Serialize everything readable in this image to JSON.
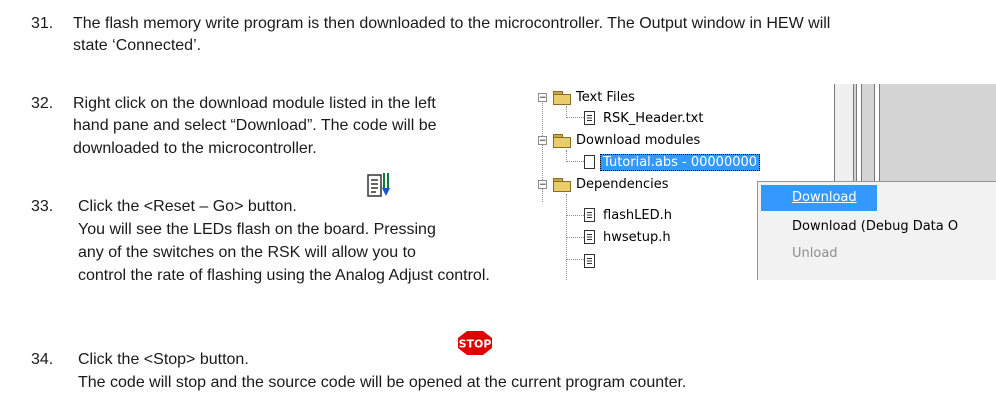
{
  "steps": [
    {
      "number": "31.",
      "lines": [
        "The flash memory write program is then downloaded to the microcontroller. The Output window in HEW will",
        "state ‘Connected’."
      ]
    },
    {
      "number": "32.",
      "lines": [
        "Right click on the download module listed in the left",
        "hand pane and select “Download”. The code will be",
        "downloaded to the microcontroller."
      ]
    },
    {
      "number": "33.",
      "lines": [
        "Click the <Reset – Go> button.",
        "You will see the LEDs flash on the board. Pressing",
        "any of the switches on the RSK will allow you to",
        "control the rate of flashing using the Analog Adjust control."
      ]
    },
    {
      "number": "34.",
      "lines": [
        "Click the <Stop> button.",
        "The code will stop and the source code will be opened at the current program counter."
      ]
    }
  ],
  "tree": {
    "text_files": "Text Files",
    "rsk_header": "RSK_Header.txt",
    "download_modules": "Download modules",
    "tutorial": "Tutorial.abs - 00000000",
    "dependencies": "Dependencies",
    "flashled": "flashLED.h",
    "hwsetup": "hwsetup.h"
  },
  "context_menu": {
    "download": "Download",
    "download_debug": "Download (Debug Data O",
    "unload": "Unload"
  },
  "stop_label": "STOP",
  "colors": {
    "selection": "#3399ff",
    "stop": "#e00000",
    "folder": "#e9cd6b"
  }
}
